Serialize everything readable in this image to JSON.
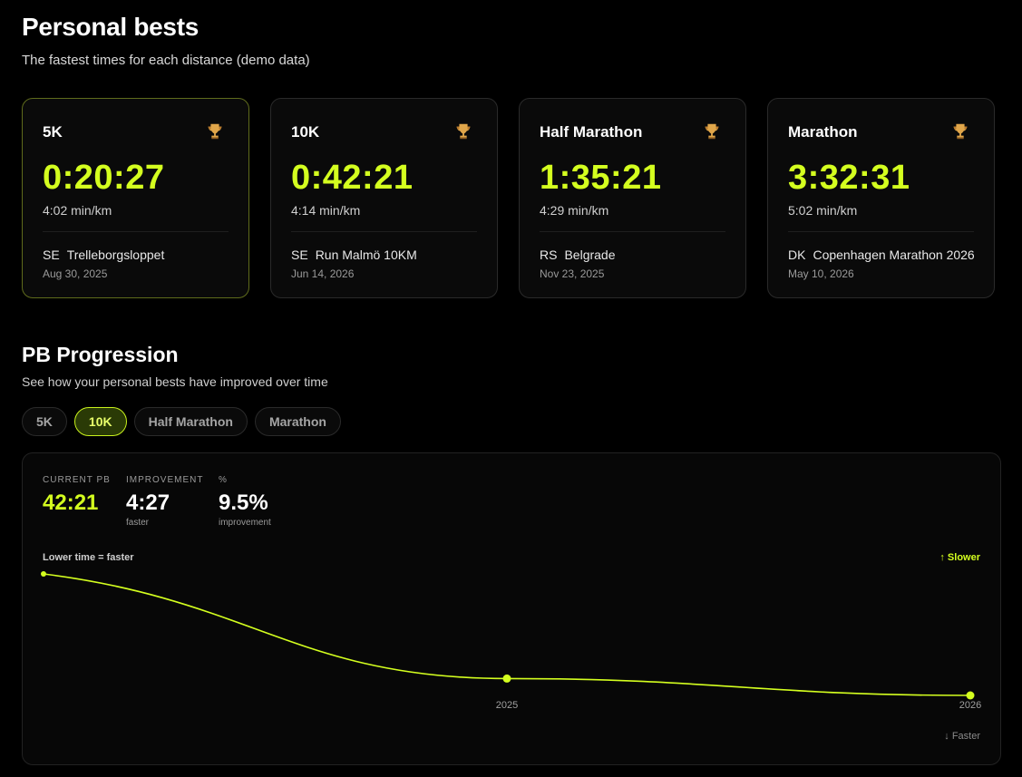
{
  "page": {
    "title": "Personal bests",
    "subtitle": "The fastest times for each distance (demo data)"
  },
  "cards": [
    {
      "distance": "5K",
      "time": "0:20:27",
      "pace": "4:02 min/km",
      "country": "SE",
      "race": "Trelleborgsloppet",
      "date": "Aug 30, 2025",
      "icon": "trophy-icon"
    },
    {
      "distance": "10K",
      "time": "0:42:21",
      "pace": "4:14 min/km",
      "country": "SE",
      "race": "Run Malmö 10KM",
      "date": "Jun 14, 2026",
      "icon": "trophy-icon"
    },
    {
      "distance": "Half Marathon",
      "time": "1:35:21",
      "pace": "4:29 min/km",
      "country": "RS",
      "race": "Belgrade",
      "date": "Nov 23, 2025",
      "icon": "trophy-icon"
    },
    {
      "distance": "Marathon",
      "time": "3:32:31",
      "pace": "5:02 min/km",
      "country": "DK",
      "race": "Copenhagen Marathon 2026",
      "date": "May 10, 2026",
      "icon": "trophy-icon"
    }
  ],
  "progression": {
    "title": "PB Progression",
    "subtitle": "See how your personal bests have improved over time",
    "tabs": [
      "5K",
      "10K",
      "Half Marathon",
      "Marathon"
    ],
    "active_tab": "10K",
    "stats": {
      "current_pb_label": "CURRENT PB",
      "current_pb": "42:21",
      "improvement_label": "IMPROVEMENT",
      "improvement": "4:27",
      "improvement_note": "faster",
      "percent_label": "%",
      "percent": "9.5%",
      "percent_note": "improvement"
    },
    "note_left": "Lower time = faster",
    "note_slower": "↑ Slower",
    "note_faster": "↓ Faster"
  },
  "chart_data": {
    "type": "line",
    "series": [
      {
        "points": [
          {
            "x": "2024",
            "y": "46:48"
          },
          {
            "x": "2025",
            "y": "42:58"
          },
          {
            "x": "2026",
            "y": "42:21"
          }
        ]
      }
    ],
    "x_tick_labels": [
      "2025",
      "2026"
    ],
    "y_direction": "inverted (lower time = faster, shown lower)",
    "grid": false,
    "color": "#d4ff1f"
  },
  "colors": {
    "accent": "#d4ff1f",
    "background": "#000000",
    "card": "#0a0a0a"
  }
}
